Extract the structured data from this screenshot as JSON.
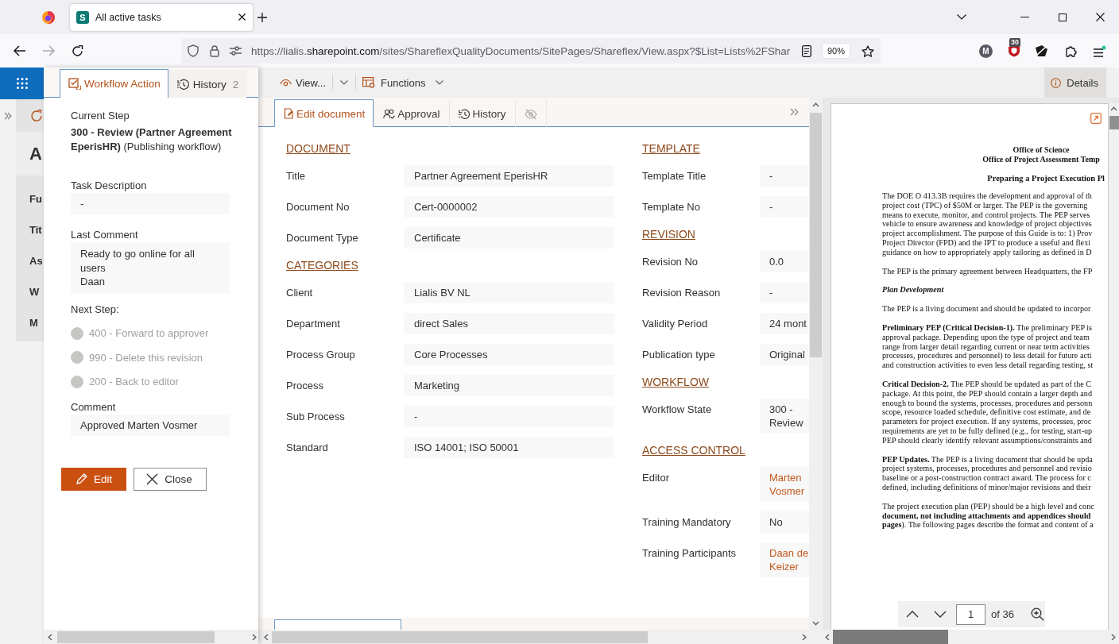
{
  "browser": {
    "tabs": [
      {
        "title": "All active tasks",
        "icon_letter": "S",
        "selected": true
      }
    ],
    "address": {
      "scheme": "https://lialis.",
      "domain": "sharepoint.com",
      "path": "/sites/ShareflexQualityDocuments/SitePages/Shareflex/View.aspx?$List=Lists%2FShar"
    },
    "zoom": "90%",
    "profile_initial": "M",
    "extension_badge": "30"
  },
  "background_page": {
    "heading": "A",
    "labels": [
      "Fu",
      "Tit",
      "As",
      "W",
      "M"
    ]
  },
  "workflow_panel": {
    "tabs": [
      {
        "label": "Workflow Action",
        "selected": true
      },
      {
        "label": "History",
        "count": "2",
        "selected": false
      }
    ],
    "current_step": {
      "label": "Current Step",
      "value": "**300 - Review (Partner Agreement EperisHR)** (Publishing workflow)"
    },
    "fields": [
      {
        "label": "Task Description",
        "lines": [
          "-"
        ]
      },
      {
        "label": "Last Comment",
        "lines": [
          "Ready to go online for all users",
          "Daan"
        ]
      }
    ],
    "next_step": {
      "label": "Next Step:",
      "options": [
        {
          "label": "400 - Forward to approver",
          "selected": false,
          "disabled": true
        },
        {
          "label": "990 - Delete this revision",
          "selected": false,
          "disabled": true
        },
        {
          "label": "200 - Back to editor",
          "selected": false,
          "disabled": true
        }
      ]
    },
    "comment": {
      "label": "Comment",
      "value": "Approved Marten Vosmer"
    },
    "buttons": [
      {
        "label": "Edit",
        "kind": "primary"
      },
      {
        "label": "Close",
        "kind": "secondary"
      }
    ]
  },
  "toolbar": {
    "view": "View...",
    "functions": "Functions"
  },
  "details_button": {
    "label": "Details",
    "selected": true
  },
  "document_form": {
    "tabs": [
      {
        "kind": "edit",
        "label": "Edit document",
        "selected": true
      },
      {
        "kind": "approval",
        "label": "Approval",
        "selected": false
      },
      {
        "kind": "history",
        "label": "History",
        "selected": false
      },
      {
        "kind": "hidden",
        "selected": false
      }
    ],
    "left_column": [
      {
        "title": "DOCUMENT",
        "fields": [
          {
            "label": "Title",
            "value": "Partner Agreement EperisHR",
            "kind": "text"
          },
          {
            "label": "Document No",
            "value": "Cert-0000002",
            "kind": "text"
          },
          {
            "label": "Document Type",
            "value": "Certificate",
            "kind": "text"
          }
        ]
      },
      {
        "title": "CATEGORIES",
        "fields": [
          {
            "label": "Client",
            "value": "Lialis BV NL",
            "kind": "text"
          },
          {
            "label": "Department",
            "value": "direct Sales",
            "kind": "text"
          },
          {
            "label": "Process Group",
            "value": "Core Processes",
            "kind": "text"
          },
          {
            "label": "Process",
            "value": "Marketing",
            "kind": "text"
          },
          {
            "label": "Sub Process",
            "value": "-",
            "kind": "text"
          },
          {
            "label": "Standard",
            "value": "ISO 14001; ISO 50001",
            "kind": "text"
          }
        ]
      }
    ],
    "right_column": [
      {
        "title": "TEMPLATE",
        "fields": [
          {
            "label": "Template Title",
            "value": "-",
            "kind": "text"
          },
          {
            "label": "Template No",
            "value": "-",
            "kind": "text"
          }
        ]
      },
      {
        "title": "REVISION",
        "fields": [
          {
            "label": "Revision No",
            "value": "0.0",
            "kind": "text"
          },
          {
            "label": "Revision Reason",
            "value": "-",
            "kind": "text"
          },
          {
            "label": "Validity Period",
            "value": "24 mont",
            "kind": "text"
          },
          {
            "label": "Publication type",
            "value": "Original",
            "kind": "text"
          }
        ]
      },
      {
        "title": "WORKFLOW",
        "fields": [
          {
            "label": "Workflow State",
            "value": "300 - Review",
            "kind": "text"
          }
        ]
      },
      {
        "title": "ACCESS CONTROL",
        "fields": [
          {
            "label": "Editor",
            "value": "Marten Vosmer",
            "kind": "person"
          },
          {
            "label": "Training Mandatory",
            "value": "No",
            "kind": "text"
          },
          {
            "label": "Training Participants",
            "value": "Daan de Keizer",
            "kind": "person"
          }
        ]
      }
    ]
  },
  "document_preview": {
    "title_lines": [
      "Office of Science",
      "Office of Project Assessment Temp"
    ],
    "subtitle": "Preparing a Project Execution Pl",
    "paragraphs": [
      {
        "kind": "text",
        "lines": [
          "The DOE O 413.3B requires the development and approval of th",
          "project cost (TPC) of $50M or larger.  The PEP is the governing",
          "means to execute, monitor, and control projects. The PEP serves",
          "vehicle to ensure awareness and knowledge of project objectives",
          "project accomplishment.  The purpose of this Guide is to: 1) Prov",
          "Project Director (FPD) and the IPT to produce a useful and flexi",
          "guidance on how to appropriately apply tailoring as defined in D"
        ]
      },
      {
        "kind": "text",
        "lines": [
          "The PEP is the primary agreement between Headquarters, the FP"
        ]
      },
      {
        "kind": "heading",
        "lines": [
          "Plan Development"
        ]
      },
      {
        "kind": "text",
        "lines": [
          "The PEP is a living  document and should be updated to incorpor"
        ]
      },
      {
        "kind": "text",
        "lines": [
          "**Preliminary PEP (Critical Decision-1).** The preliminary  PEP is",
          "approval package. Depending upon the type of project and team",
          "range from larger detail regarding current or near term activities",
          "processes, procedures and personnel) to less detail for future acti",
          "and construction activities to even less detail regarding testing, st"
        ]
      },
      {
        "kind": "text",
        "lines": [
          "**Critical Decision-2.** The PEP should be updated as part of the C",
          "package. At this point, the PEP should contain a larger depth and",
          "enough to bound the systems, processes, procedures and personn",
          "scope, resource loaded schedule, definitive cost estimate, and de",
          "parameters for project execution.  If any systems, processes, proc",
          "requirements are yet to be fully defined (e.g., for testing, start-up",
          "PEP should clearly identify relevant assumptions/constraints and"
        ]
      },
      {
        "kind": "text",
        "lines": [
          "**PEP Updates.** The PEP is a living document that should be upda",
          "project systems, processes, procedures and personnel and revisio",
          "baseline or a post-construction contract award. The process for c",
          "defined, including definitions of minor/major revisions and their"
        ]
      },
      {
        "kind": "text",
        "lines": [
          "The project execution plan (PEP) should be a high level and conc",
          "**document, not including attachments and appendices should**",
          "**pages**). The following pages describe the format and content of a"
        ]
      }
    ],
    "pager": {
      "page": "1",
      "total": "of 36"
    }
  }
}
